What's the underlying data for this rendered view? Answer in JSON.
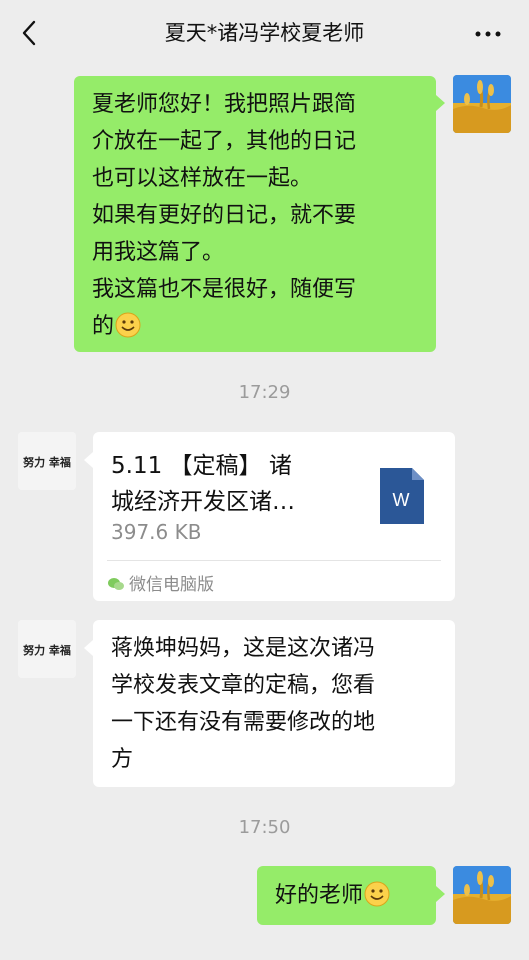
{
  "header": {
    "title": "夏天*诸冯学校夏老师"
  },
  "messages": {
    "m1_lines": [
      "夏老师您好！我把照片跟简",
      "介放在一起了，其他的日记",
      "也可以这样放在一起。",
      "如果有更好的日记，就不要",
      "用我这篇了。",
      "我这篇也不是很好，随便写",
      "的"
    ],
    "time1": "17:29",
    "file": {
      "title_line1": "5.11 【定稿】 诸",
      "title_line2": "城经济开发区诸…",
      "size": "397.6 KB",
      "source": "微信电脑版",
      "icon_letter": "W"
    },
    "m3_lines": [
      "蒋焕坤妈妈，这是这次诸冯",
      "学校发表文章的定稿，您看",
      "一下还有没有需要修改的地",
      "方"
    ],
    "time2": "17:50",
    "m4_text": "好的老师"
  },
  "avatars": {
    "logo_text": "努力 幸福"
  },
  "colors": {
    "background": "#ededed",
    "self_bubble": "#95ec69",
    "other_bubble": "#ffffff",
    "word_icon": "#2b5797"
  },
  "icons": [
    "back-chevron-icon",
    "more-dots-icon",
    "smile-emoji-icon",
    "word-file-icon",
    "wechat-pc-icon"
  ]
}
